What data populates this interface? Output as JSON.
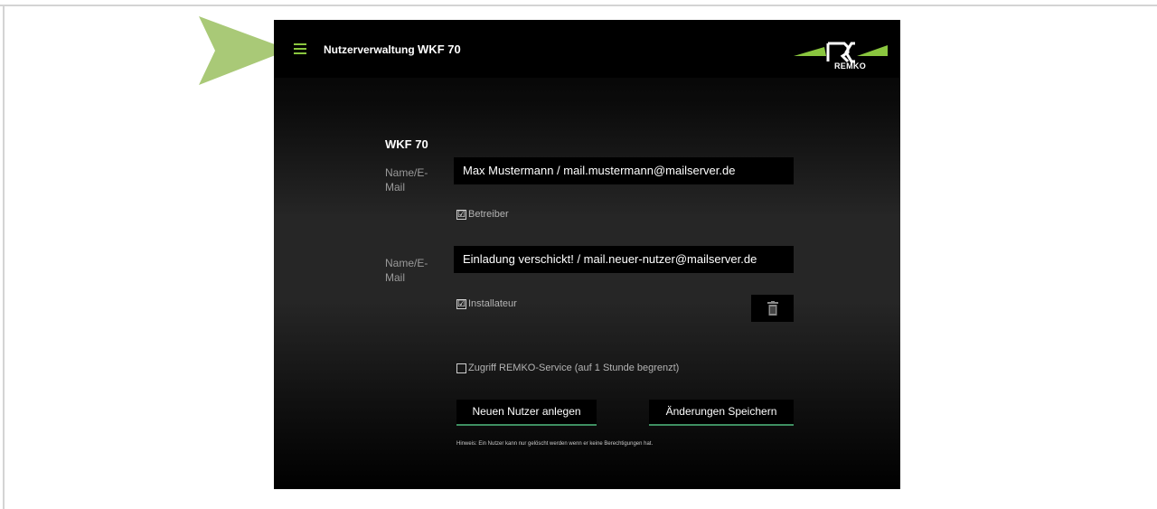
{
  "header": {
    "title_prefix": "Nutzerverwaltung",
    "title_unit": "WKF 70",
    "brand": "REMKO"
  },
  "form": {
    "section_title": "WKF 70",
    "users": [
      {
        "label": "Name/E-Mail",
        "value": "Max Mustermann / mail.mustermann@mailserver.de",
        "role_label": "Betreiber",
        "role_checked": "☑"
      },
      {
        "label": "Name/E-Mail",
        "value": "Einladung verschickt! / mail.neuer-nutzer@mailserver.de",
        "role_label": "Installateur",
        "role_checked": "☑"
      }
    ],
    "service_access_label": "Zugriff REMKO-Service (auf 1 Stunde begrenzt)",
    "service_access_checked": "",
    "new_user_button": "Neuen Nutzer anlegen",
    "save_button": "Änderungen Speichern",
    "hint": "Hinweis: Ein Nutzer kann nur gelöscht werden wenn er keine Berechtigungen hat."
  },
  "icons": {
    "menu": "hamburger-menu-icon",
    "delete": "trash-icon",
    "pointer": "arrow-pointer-icon"
  },
  "colors": {
    "accent_green": "#8ac63f",
    "pointer_green": "#a9c977",
    "button_underline": "#3e8f61",
    "header_bg": "#000000"
  }
}
